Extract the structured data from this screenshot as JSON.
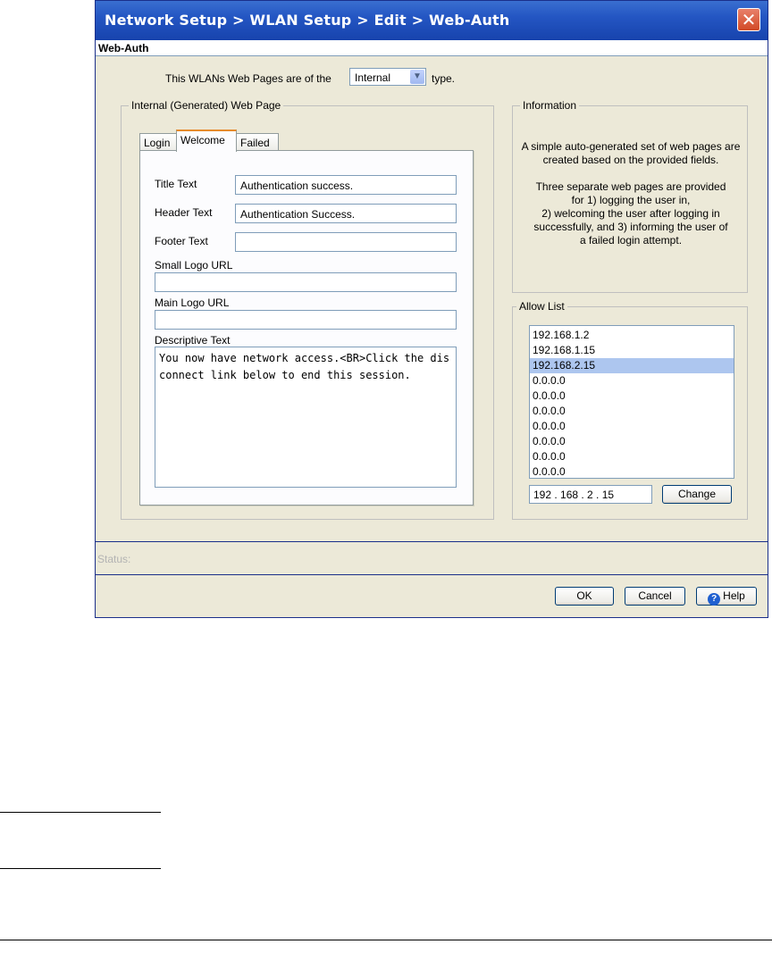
{
  "window": {
    "title": "Network Setup > WLAN Setup > Edit > Web-Auth",
    "close_icon": "close-icon"
  },
  "panel_header": "Web-Auth",
  "type_row": {
    "prefix": "This WLANs Web Pages are of the",
    "selected": "Internal",
    "suffix": "type."
  },
  "internal_page": {
    "legend": "Internal (Generated) Web Page",
    "tabs": [
      "Login",
      "Welcome",
      "Failed"
    ],
    "active_tab": "Welcome",
    "fields": {
      "title_text_label": "Title Text",
      "title_text_value": "Authentication success.",
      "header_text_label": "Header Text",
      "header_text_value": "Authentication Success.",
      "footer_text_label": "Footer Text",
      "footer_text_value": "",
      "small_logo_label": "Small Logo URL",
      "small_logo_value": "",
      "main_logo_label": "Main Logo URL",
      "main_logo_value": "",
      "descriptive_label": "Descriptive Text",
      "descriptive_value": "You now have network access.<BR>Click the disconnect link below to end this session."
    }
  },
  "information": {
    "legend": "Information",
    "para1": "A simple auto-generated set of web pages are created based on the provided fields.",
    "para2_l1": "Three separate web pages are provided",
    "para2_l2": "for 1) logging the user in,",
    "para2_l3": "2) welcoming the user after logging in",
    "para2_l4": "successfully, and 3) informing the user of",
    "para2_l5": "a failed login attempt."
  },
  "allow_list": {
    "legend": "Allow List",
    "items": [
      "192.168.1.2",
      "192.168.1.15",
      "192.168.2.15",
      "0.0.0.0",
      "0.0.0.0",
      "0.0.0.0",
      "0.0.0.0",
      "0.0.0.0",
      "0.0.0.0",
      "0.0.0.0"
    ],
    "selected_index": 2,
    "ip_input": "192 . 168 .  2  . 15",
    "change_label": "Change"
  },
  "status": {
    "label": "Status:"
  },
  "buttons": {
    "ok": "OK",
    "cancel": "Cancel",
    "help": "Help",
    "help_icon": "help-icon"
  }
}
